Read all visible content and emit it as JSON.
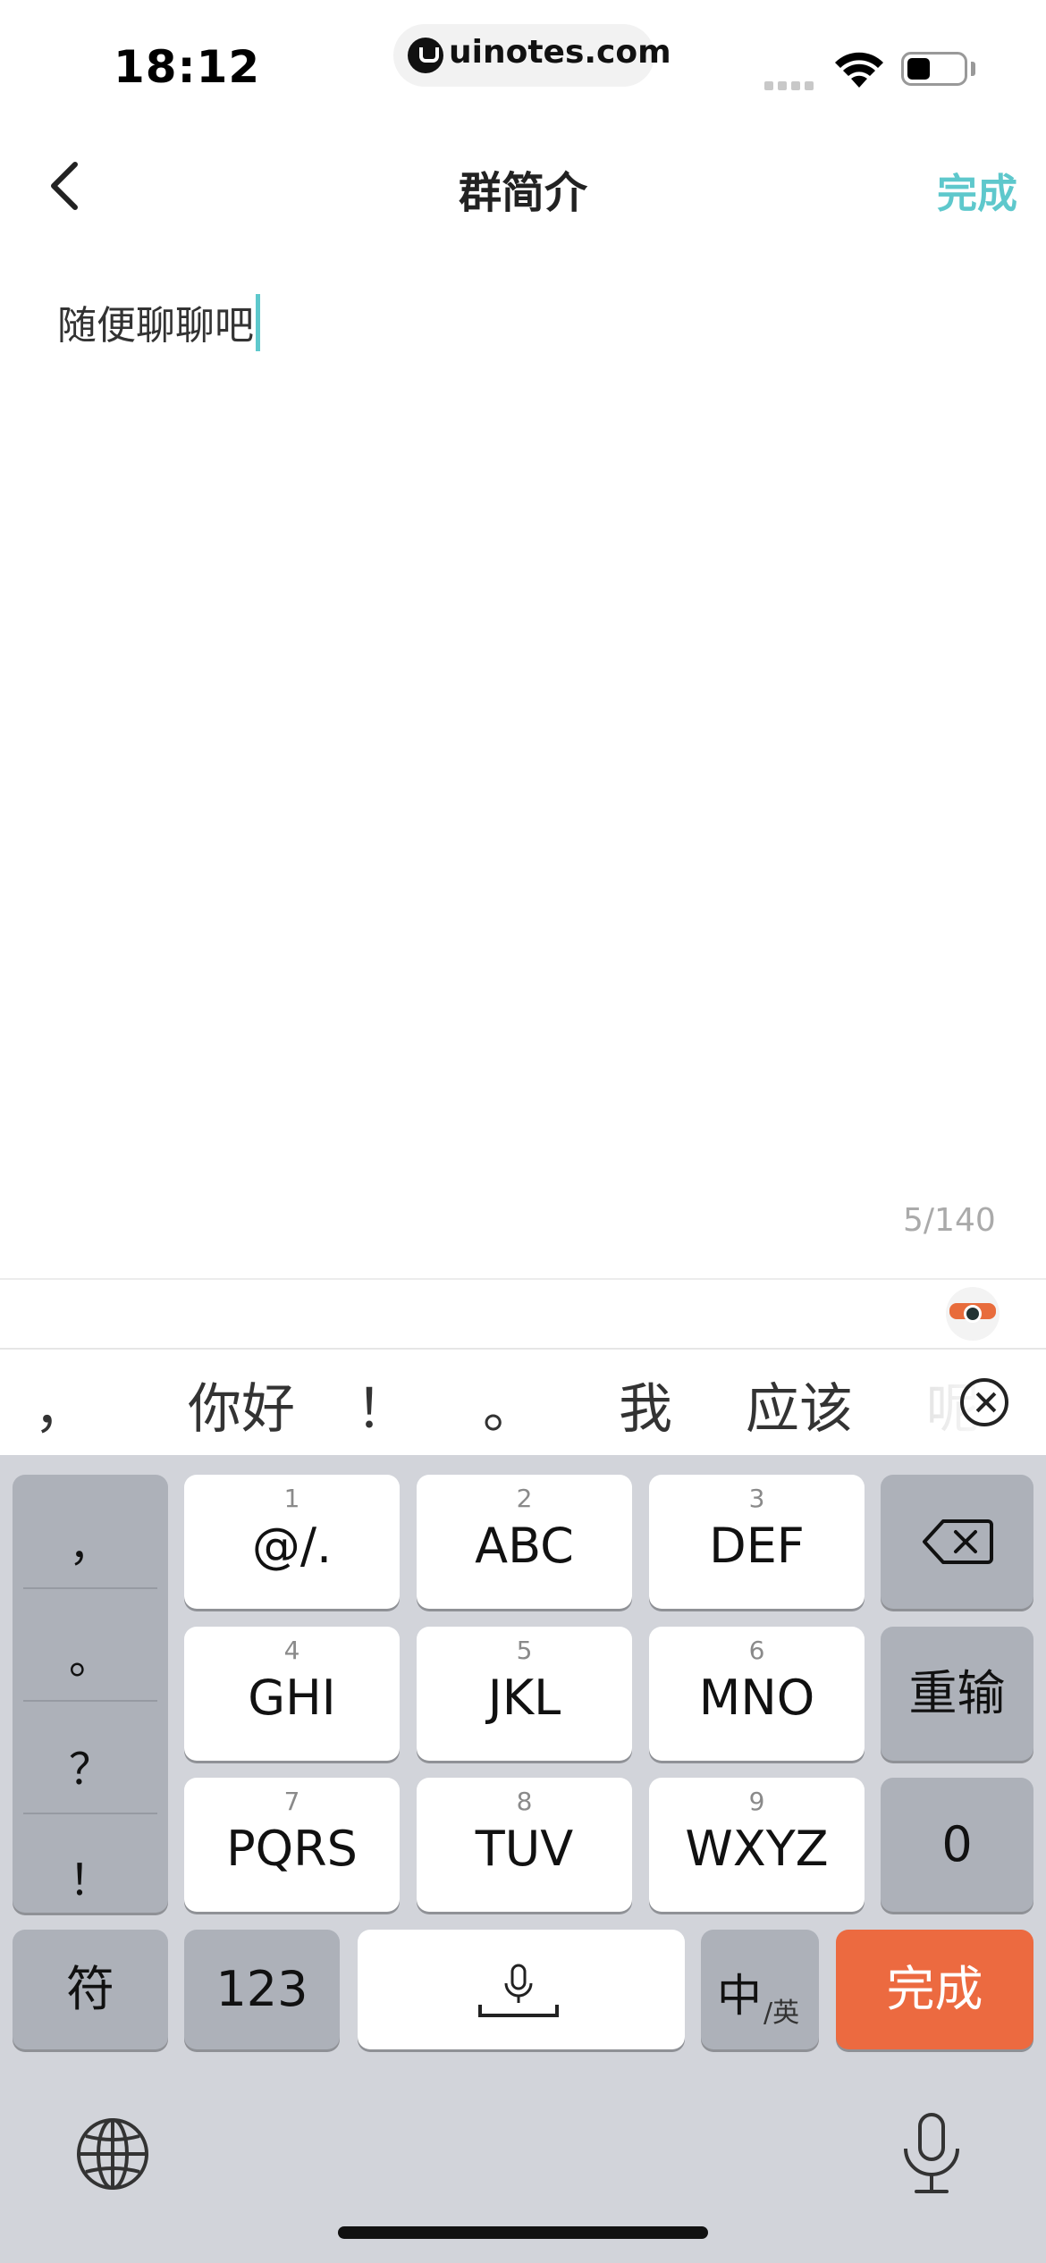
{
  "status_bar": {
    "time": "18:12",
    "url": "uinotes.com"
  },
  "nav": {
    "title": "群简介",
    "done_label": "完成"
  },
  "editor": {
    "text": "随便聊聊吧",
    "counter": "5/140"
  },
  "candidates": [
    "，",
    "你好",
    "！",
    "。",
    "我",
    "应该",
    "呢"
  ],
  "keyboard": {
    "punct_column": [
      "，",
      "。",
      "？",
      "！"
    ],
    "keys": [
      {
        "num": "1",
        "label": "@/."
      },
      {
        "num": "2",
        "label": "ABC"
      },
      {
        "num": "3",
        "label": "DEF"
      },
      {
        "num": "4",
        "label": "GHI"
      },
      {
        "num": "5",
        "label": "JKL"
      },
      {
        "num": "6",
        "label": "MNO"
      },
      {
        "num": "7",
        "label": "PQRS"
      },
      {
        "num": "8",
        "label": "TUV"
      },
      {
        "num": "9",
        "label": "WXYZ"
      }
    ],
    "retype_label": "重输",
    "zero_label": "0",
    "symbols_label": "符",
    "numbers_label": "123",
    "lang_main": "中",
    "lang_sub": "/英",
    "done_label": "完成"
  },
  "colors": {
    "accent": "#5ec8cc",
    "done_key": "#ec6a40",
    "keyboard_bg": "#d2d4da"
  },
  "icons": [
    "back-icon",
    "wifi-icon",
    "battery-icon",
    "close-icon",
    "delete-icon",
    "space-mic-icon",
    "globe-icon",
    "mic-icon",
    "mascot-icon"
  ]
}
